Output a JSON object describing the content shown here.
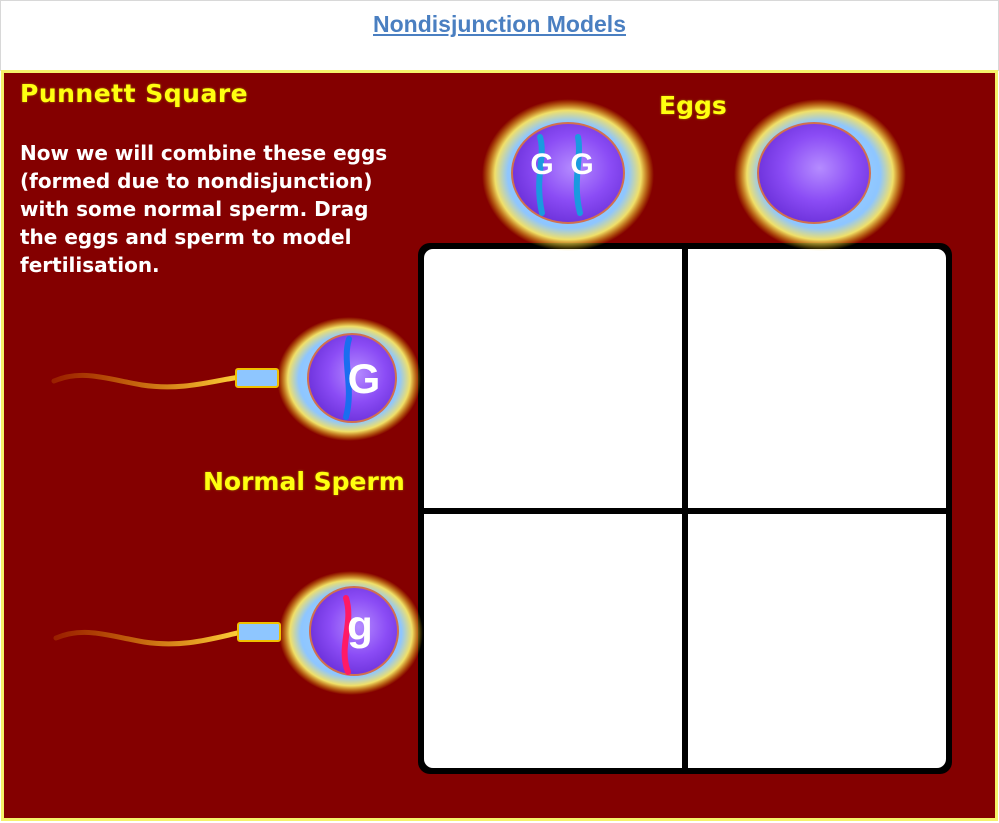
{
  "page": {
    "title": "Nondisjunction Models"
  },
  "activity": {
    "heading": "Punnett Square",
    "instructions": "Now we will combine these eggs (formed due to nondisjunction) with some normal sperm.  Drag the eggs and sperm to model fertilisation.",
    "eggs_label": "Eggs",
    "sperm_label": "Normal Sperm"
  },
  "eggs": [
    {
      "name": "egg-nondisjunction",
      "alleles": [
        "G",
        "G"
      ]
    },
    {
      "name": "egg-empty",
      "alleles": []
    }
  ],
  "sperm": [
    {
      "name": "sperm-dominant",
      "allele": "G",
      "chromosome_color": "#1a6ef0"
    },
    {
      "name": "sperm-recessive",
      "allele": "g",
      "chromosome_color": "#ff1a66"
    }
  ],
  "punnett": {
    "rows": 2,
    "cols": 2
  },
  "colors": {
    "background": "#840000",
    "border": "#f5f26a",
    "title_link": "#4a7fc1",
    "label_yellow": "#ffff10"
  }
}
